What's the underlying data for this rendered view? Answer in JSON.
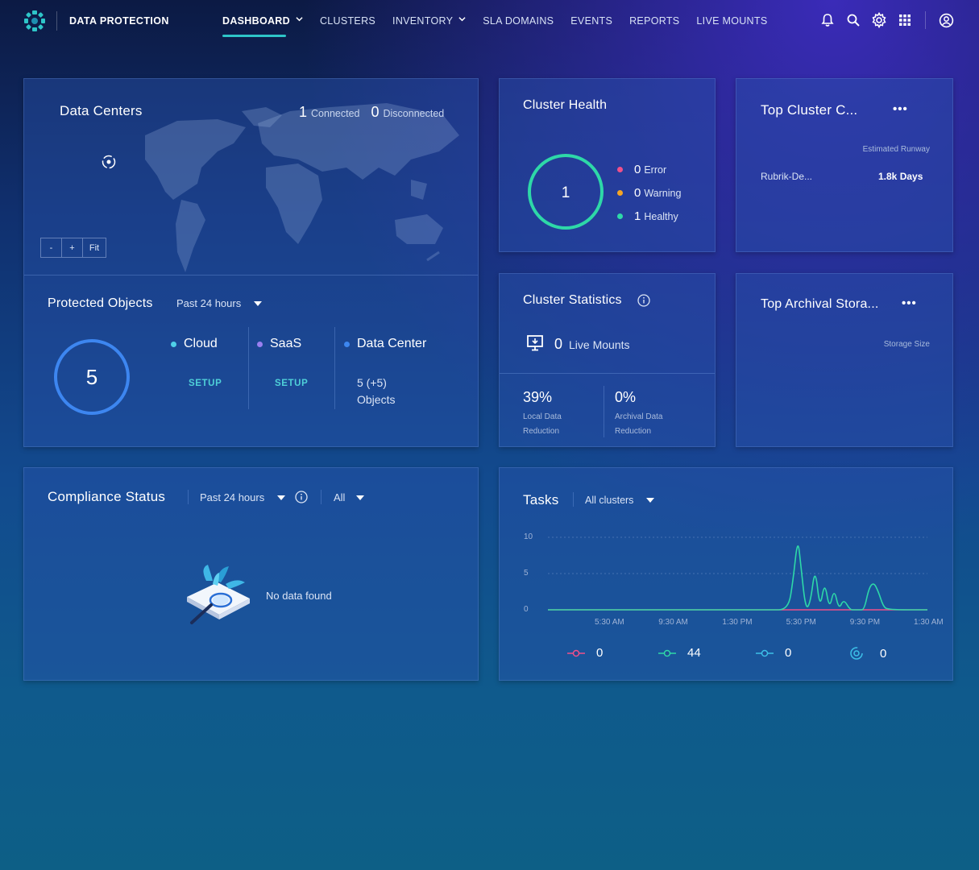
{
  "header": {
    "brand": "DATA PROTECTION",
    "nav": [
      {
        "label": "DASHBOARD",
        "active": true,
        "dropdown": true
      },
      {
        "label": "CLUSTERS",
        "active": false,
        "dropdown": false
      },
      {
        "label": "INVENTORY",
        "active": false,
        "dropdown": true
      },
      {
        "label": "SLA DOMAINS",
        "active": false,
        "dropdown": false
      },
      {
        "label": "EVENTS",
        "active": false,
        "dropdown": false
      },
      {
        "label": "REPORTS",
        "active": false,
        "dropdown": false
      },
      {
        "label": "LIVE MOUNTS",
        "active": false,
        "dropdown": false
      }
    ],
    "icons": [
      "bell-icon",
      "search-icon",
      "gear-icon",
      "apps-grid-icon",
      "user-account-icon"
    ]
  },
  "data_centers": {
    "title": "Data Centers",
    "connected_count": "1",
    "connected_label": "Connected",
    "disconnected_count": "0",
    "disconnected_label": "Disconnected",
    "zoom_out": "-",
    "zoom_in": "+",
    "zoom_fit": "Fit"
  },
  "protected_objects": {
    "title": "Protected Objects",
    "range": "Past 24 hours",
    "total": "5",
    "columns": [
      {
        "name": "Cloud",
        "color": "#4fd0e8",
        "action": "SETUP"
      },
      {
        "name": "SaaS",
        "color": "#9a7ff0",
        "action": "SETUP"
      },
      {
        "name": "Data Center",
        "color": "#3d86f0",
        "count": "5 (+5)",
        "unit": "Objects"
      }
    ]
  },
  "cluster_health": {
    "title": "Cluster Health",
    "total": "1",
    "rows": [
      {
        "count": "0",
        "label": "Error",
        "color": "#f0508a"
      },
      {
        "count": "0",
        "label": "Warning",
        "color": "#f5a524"
      },
      {
        "count": "1",
        "label": "Healthy",
        "color": "#2ed8a8"
      }
    ]
  },
  "top_cluster": {
    "title": "Top Cluster C...",
    "menu": "•••",
    "column_label": "Estimated Runway",
    "rows": [
      {
        "name": "Rubrik-De...",
        "value": "1.8k Days"
      }
    ]
  },
  "cluster_stats": {
    "title": "Cluster Statistics",
    "live_mounts_count": "0",
    "live_mounts_label": "Live Mounts",
    "local_value": "39%",
    "local_label_1": "Local Data",
    "local_label_2": "Reduction",
    "archival_value": "0%",
    "archival_label_1": "Archival Data",
    "archival_label_2": "Reduction"
  },
  "top_archival": {
    "title": "Top Archival Stora...",
    "menu": "•••",
    "column_label": "Storage Size"
  },
  "compliance": {
    "title": "Compliance Status",
    "range": "Past 24 hours",
    "filter": "All",
    "empty": "No data found"
  },
  "tasks": {
    "title": "Tasks",
    "filter": "All clusters",
    "legend": [
      {
        "value": "0",
        "color": "#f0508a",
        "icon": "failed-task-icon"
      },
      {
        "value": "44",
        "color": "#2ed8a8",
        "icon": "succeeded-task-icon"
      },
      {
        "value": "0",
        "color": "#3cc0e8",
        "icon": "canceled-task-icon"
      },
      {
        "value": "0",
        "color": "#3cc0e8",
        "icon": "running-task-icon"
      }
    ]
  },
  "chart_data": {
    "type": "line",
    "yticks": [
      "10",
      "5",
      "0"
    ],
    "ylim": [
      0,
      10
    ],
    "xticks": [
      "5:30 AM",
      "9:30 AM",
      "1:30 PM",
      "5:30 PM",
      "9:30 PM",
      "1:30 AM"
    ],
    "x": [
      0,
      4,
      8,
      12,
      14,
      15.2,
      15.5,
      15.8,
      16.0,
      16.3,
      16.6,
      16.9,
      17.2,
      17.5,
      17.8,
      18.1,
      18.4,
      18.7,
      19.1,
      19.4,
      19.7,
      20.0,
      20.3,
      20.6,
      20.9,
      21.2,
      21.5,
      24
    ],
    "series": [
      {
        "color": "#f0508a",
        "values": [
          0,
          0,
          0,
          0,
          0,
          0,
          0,
          0,
          0,
          0,
          0,
          0,
          0,
          0,
          0,
          0,
          0,
          0,
          0,
          0,
          0,
          0,
          0,
          0,
          0,
          0,
          0,
          0
        ]
      },
      {
        "color": "#2ed8a8",
        "values": [
          0,
          0,
          0,
          0,
          0,
          0,
          4,
          10,
          6,
          0,
          1,
          6,
          0,
          4,
          0,
          3,
          0,
          1.5,
          0,
          0,
          0,
          0,
          3,
          3.8,
          2.5,
          0.5,
          0,
          0
        ]
      }
    ]
  }
}
